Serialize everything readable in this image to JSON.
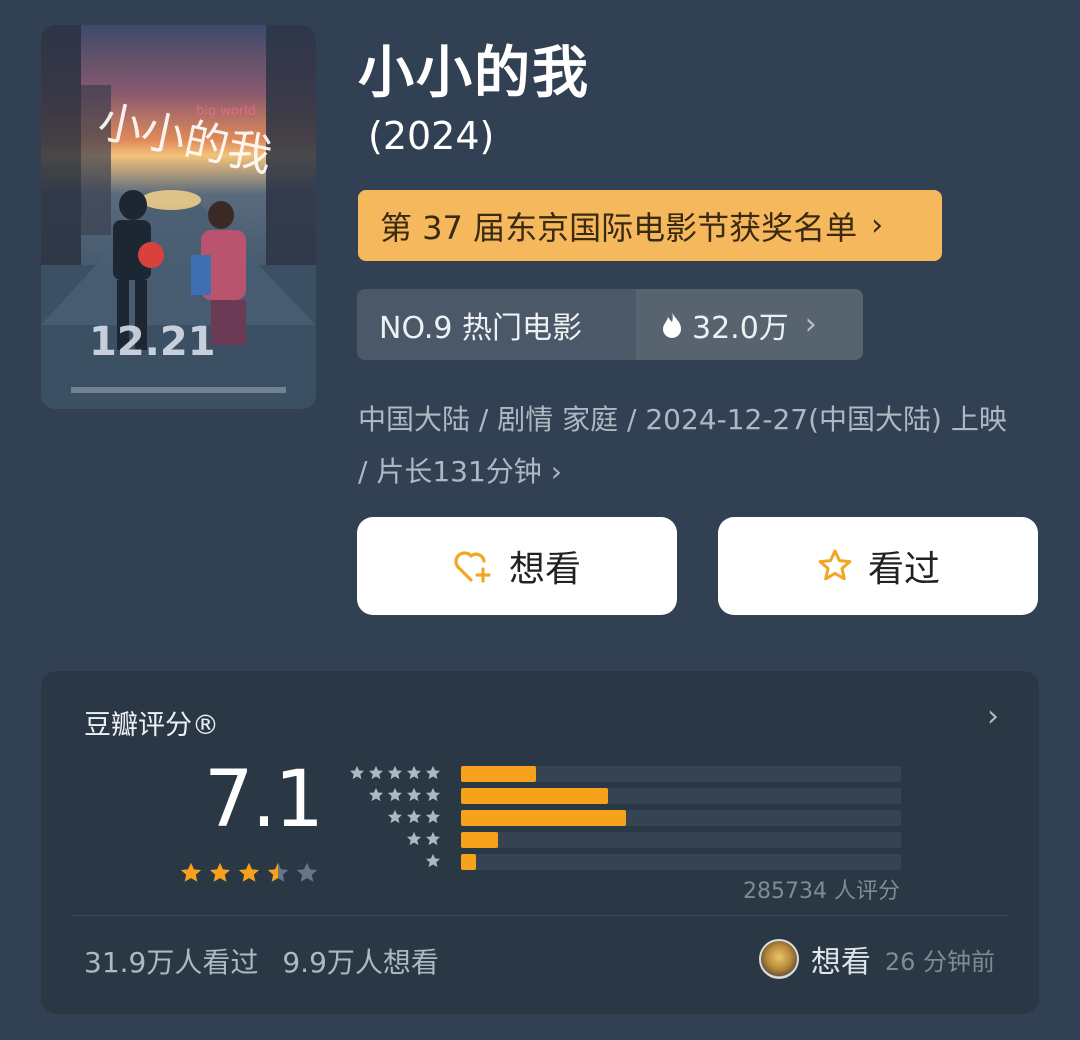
{
  "movie": {
    "title": "小小的我",
    "year": "(2024)",
    "award": "第 37 届东京国际电影节获奖名单",
    "rank_label": "NO.9 热门电影",
    "heat": "32.0万",
    "meta": "中国大陆 / 剧情 家庭 / 2024-12-27(中国大陆) 上映 / 片长131分钟"
  },
  "poster": {
    "handwriting": "小小的我",
    "subtitle": "big world",
    "date": "12.21"
  },
  "actions": {
    "want_label": "想看",
    "seen_label": "看过"
  },
  "rating": {
    "title": "豆瓣评分®",
    "score": "7.1",
    "stars_value": 3.5,
    "distribution": [
      {
        "stars": 5,
        "fraction": 0.17
      },
      {
        "stars": 4,
        "fraction": 0.335
      },
      {
        "stars": 3,
        "fraction": 0.375
      },
      {
        "stars": 2,
        "fraction": 0.085
      },
      {
        "stars": 1,
        "fraction": 0.035
      }
    ],
    "count": "285734 人评分",
    "seen_count": "31.9万人看过",
    "want_count": "9.9万人想看",
    "friend_action": "想看",
    "friend_time": "26 分钟前"
  },
  "colors": {
    "accent": "#f6b85c",
    "bar": "#f7a21b",
    "background": "#314052",
    "card": "#2a3745"
  }
}
